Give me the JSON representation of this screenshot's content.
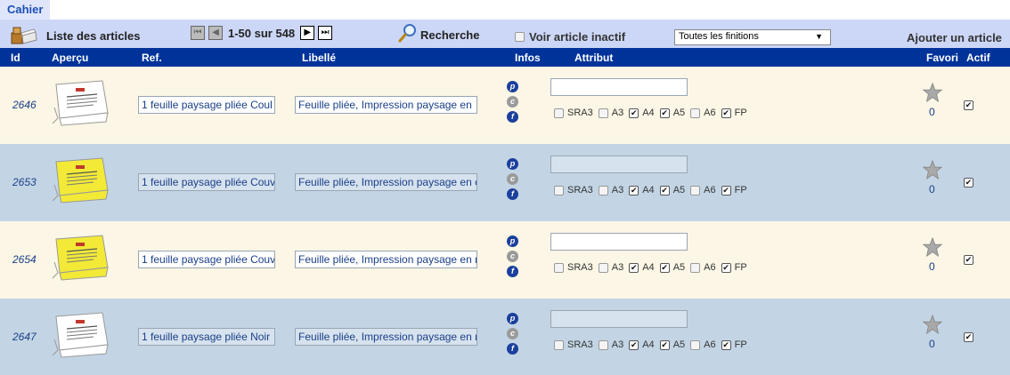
{
  "tab": {
    "label": "Cahier"
  },
  "toolbar": {
    "title": "Liste des articles",
    "pager_text": "1-50 sur 548",
    "search_label": "Recherche",
    "inactive_label": "Voir article inactif",
    "inactive_checked": false,
    "finish_select": "Toutes les finitions",
    "add_label": "Ajouter un article"
  },
  "header": {
    "id": "Id",
    "preview": "Aperçu",
    "ref": "Ref.",
    "label": "Libellé",
    "infos": "Infos",
    "attribute": "Attribut",
    "favorite": "Favori",
    "active": "Actif"
  },
  "attribute_labels": [
    "SRA3",
    "A3",
    "A4",
    "A5",
    "A6",
    "FP"
  ],
  "rows": [
    {
      "id": "2646",
      "ref": "1 feuille paysage pliée Coul",
      "libelle": "Feuille pliée, Impression  paysage en",
      "thumb_color": "#ffffff",
      "attribute_value": "",
      "checks": [
        false,
        false,
        true,
        true,
        false,
        true
      ],
      "favorites": "0",
      "active": true
    },
    {
      "id": "2653",
      "ref": "1 feuille paysage pliée Couv",
      "libelle": "Feuille pliée, Impression paysage en c",
      "thumb_color": "#f2ea36",
      "attribute_value": "",
      "checks": [
        false,
        false,
        true,
        true,
        false,
        true
      ],
      "favorites": "0",
      "active": true
    },
    {
      "id": "2654",
      "ref": "1 feuille paysage pliée Couv",
      "libelle": "Feuille pliée, Impression paysage en r",
      "thumb_color": "#f2ea36",
      "attribute_value": "",
      "checks": [
        false,
        false,
        true,
        true,
        false,
        true
      ],
      "favorites": "0",
      "active": true
    },
    {
      "id": "2647",
      "ref": "1 feuille paysage pliée Noir",
      "libelle": "Feuille pliée, Impression paysage en r",
      "thumb_color": "#ffffff",
      "attribute_value": "",
      "checks": [
        false,
        false,
        true,
        true,
        false,
        true
      ],
      "favorites": "0",
      "active": true
    }
  ],
  "colors": {
    "header_bg": "#003399",
    "toolbar_bg": "#ccd7f7",
    "row_cream": "#fbf6e5",
    "row_blue": "#c3d5e5",
    "link_blue": "#1a3f88"
  },
  "icons": {
    "toolbar": "articles-box-icon",
    "pager": [
      "first-page-icon",
      "previous-page-icon",
      "next-page-icon",
      "last-page-icon"
    ],
    "search": "magnifier-icon",
    "info": [
      "info-p-icon",
      "info-c-icon",
      "info-f-icon"
    ],
    "favorite": "star-icon"
  }
}
